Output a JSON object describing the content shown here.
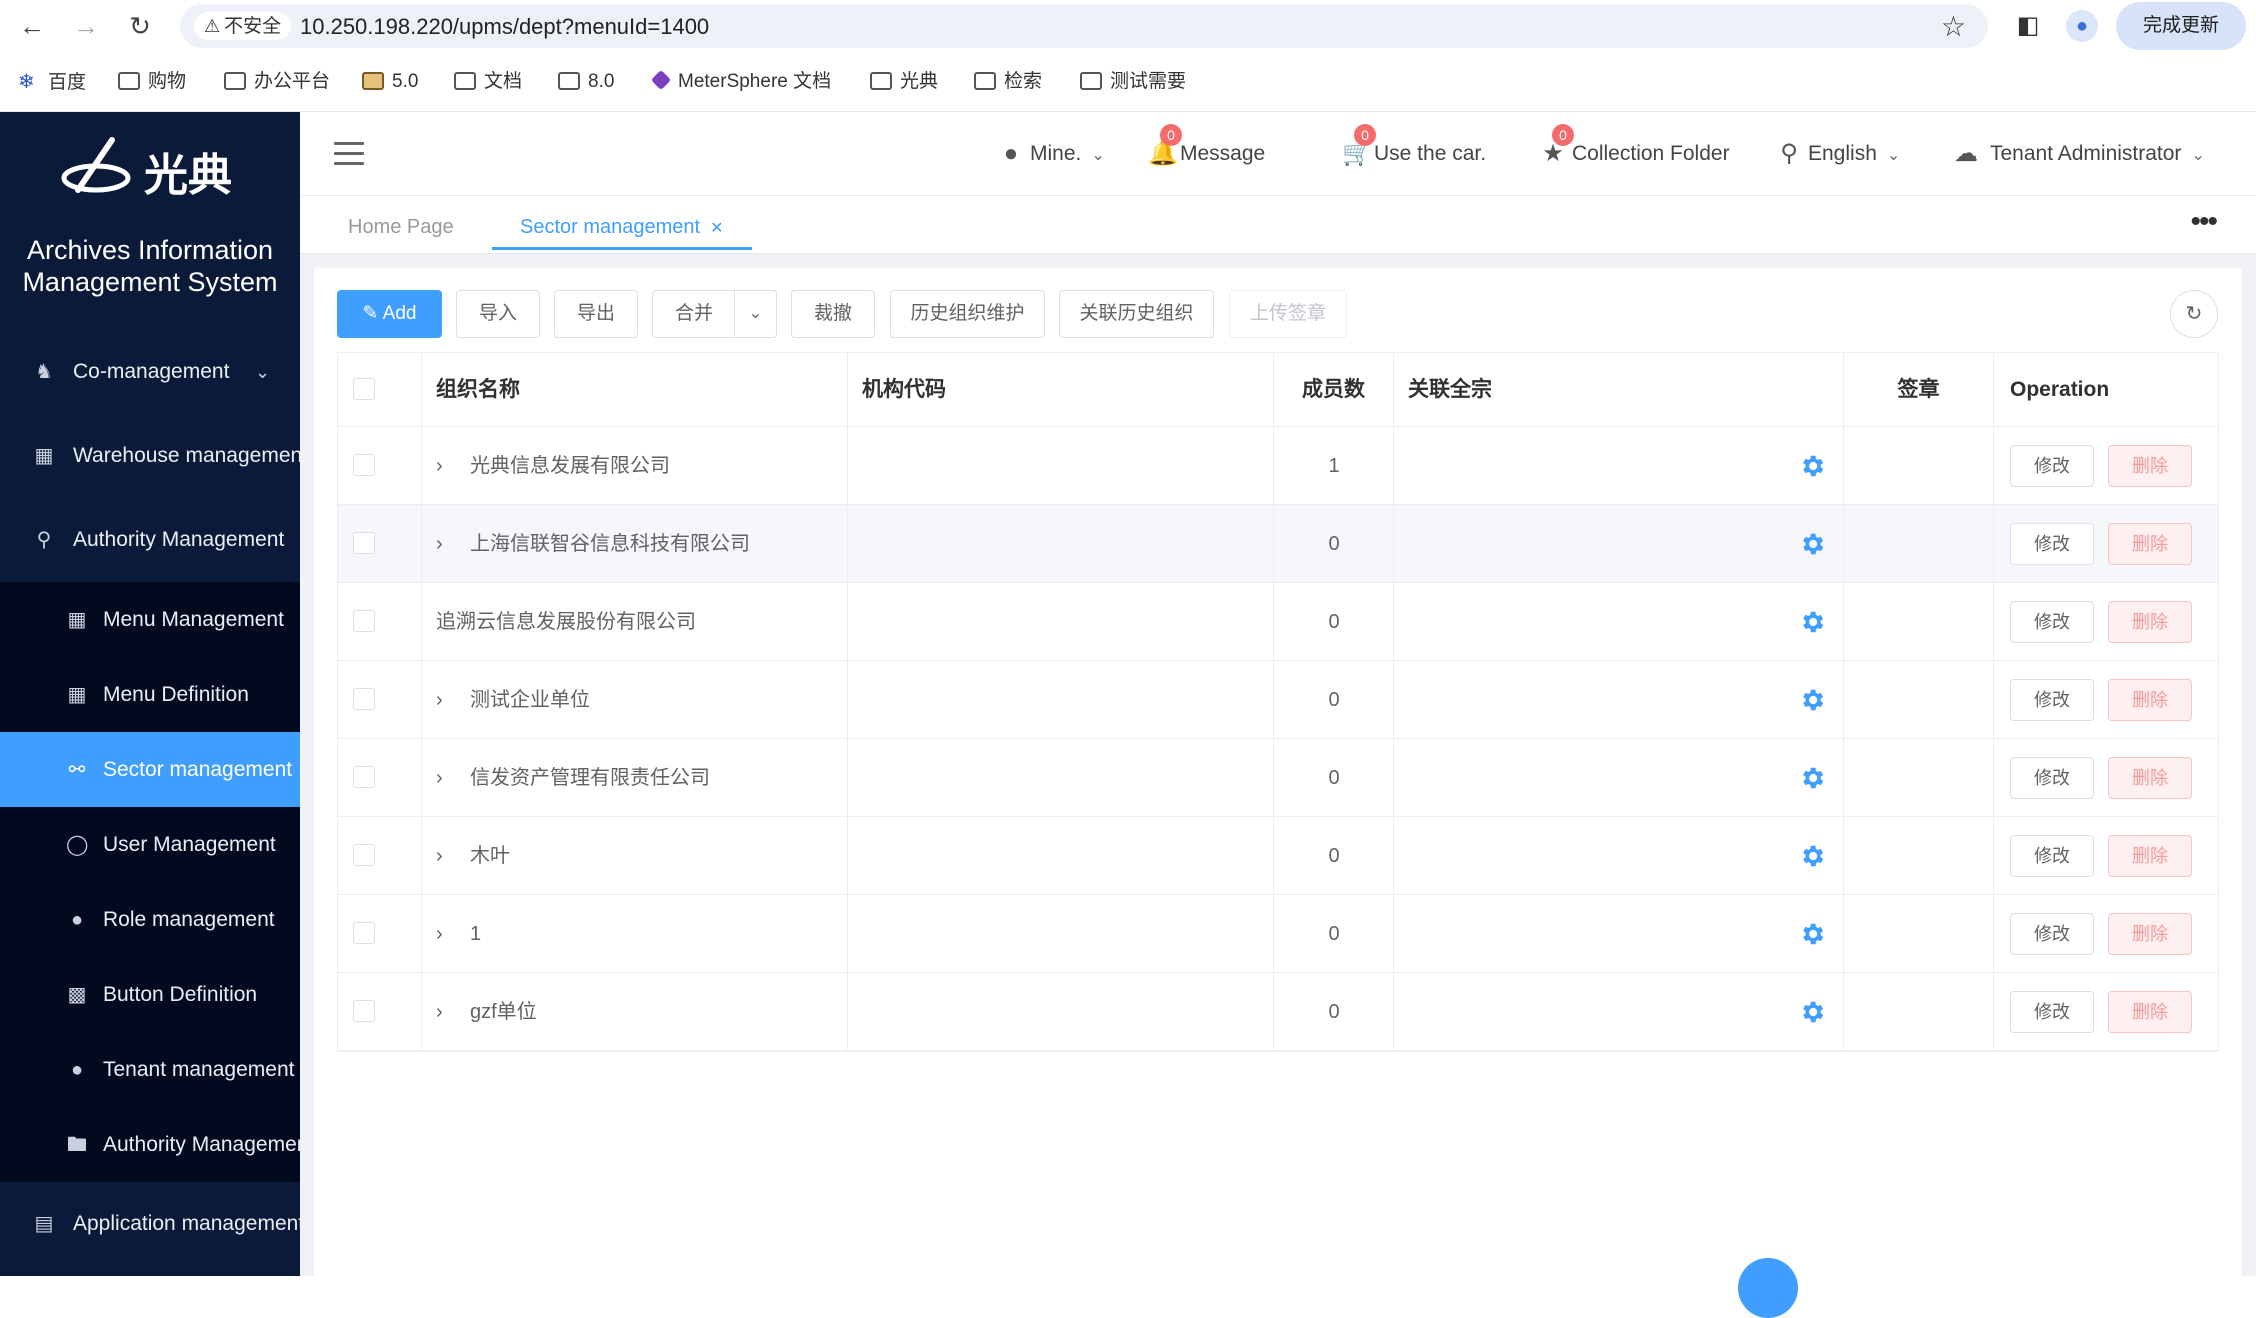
{
  "browser": {
    "insecure_label": "不安全",
    "url": "10.250.198.220/upms/dept?menuId=1400",
    "update_label": "完成更新",
    "bookmarks": [
      "百度",
      "购物",
      "办公平台",
      "5.0",
      "文档",
      "8.0",
      "MeterSphere 文档",
      "光典",
      "检索",
      "测试需要"
    ]
  },
  "sidebar": {
    "logo_text": "光典",
    "system_name_line1": "Archives Information",
    "system_name_line2": "Management System",
    "items": [
      {
        "label": "Co-management",
        "icon": "user-group-icon"
      },
      {
        "label": "Warehouse management",
        "icon": "building-icon"
      },
      {
        "label": "Authority Management",
        "icon": "key-icon"
      }
    ],
    "sub_items": [
      {
        "label": "Menu Management",
        "icon": "grid-icon"
      },
      {
        "label": "Menu Definition",
        "icon": "grid-dots-icon"
      },
      {
        "label": "Sector management",
        "icon": "org-chart-icon",
        "active": true
      },
      {
        "label": "User Management",
        "icon": "user-icon"
      },
      {
        "label": "Role management",
        "icon": "user-solid-icon"
      },
      {
        "label": "Button Definition",
        "icon": "button-icon"
      },
      {
        "label": "Tenant management",
        "icon": "user-solid-icon"
      },
      {
        "label": "Authority Management",
        "icon": "folder-icon"
      }
    ],
    "bottom_item": {
      "label": "Application management",
      "icon": "clipboard-icon"
    }
  },
  "header": {
    "mine": "Mine.",
    "message": "Message",
    "message_count": "0",
    "car": "Use the car.",
    "car_count": "0",
    "collection": "Collection Folder",
    "collection_count": "0",
    "language": "English",
    "tenant": "Tenant Administrator"
  },
  "tabs": [
    {
      "label": "Home Page"
    },
    {
      "label": "Sector management",
      "active": true
    }
  ],
  "toolbar": {
    "add": "Add",
    "import": "导入",
    "export": "导出",
    "merge": "合并",
    "cut": "裁撤",
    "history_maint": "历史组织维护",
    "link_history": "关联历史组织",
    "upload_seal": "上传签章"
  },
  "table": {
    "columns": [
      "组织名称",
      "机构代码",
      "成员数",
      "关联全宗",
      "签章",
      "Operation"
    ],
    "rows": [
      {
        "name": "光典信息发展有限公司",
        "code": "",
        "members": "1",
        "expandable": true
      },
      {
        "name": "上海信联智谷信息科技有限公司",
        "code": "",
        "members": "0",
        "expandable": true
      },
      {
        "name": "追溯云信息发展股份有限公司",
        "code": "",
        "members": "0",
        "expandable": false
      },
      {
        "name": "测试企业单位",
        "code": "",
        "members": "0",
        "expandable": true
      },
      {
        "name": "信发资产管理有限责任公司",
        "code": "",
        "members": "0",
        "expandable": true
      },
      {
        "name": "木叶",
        "code": "",
        "members": "0",
        "expandable": true
      },
      {
        "name": "1",
        "code": "",
        "members": "0",
        "expandable": true
      },
      {
        "name": "gzf单位",
        "code": "",
        "members": "0",
        "expandable": true
      }
    ],
    "edit_label": "修改",
    "delete_label": "删除"
  },
  "colors": {
    "primary": "#409eff",
    "sidebar_bg": "#0b1a38",
    "submenu_bg": "#030a1f",
    "danger": "#f56c6c"
  }
}
